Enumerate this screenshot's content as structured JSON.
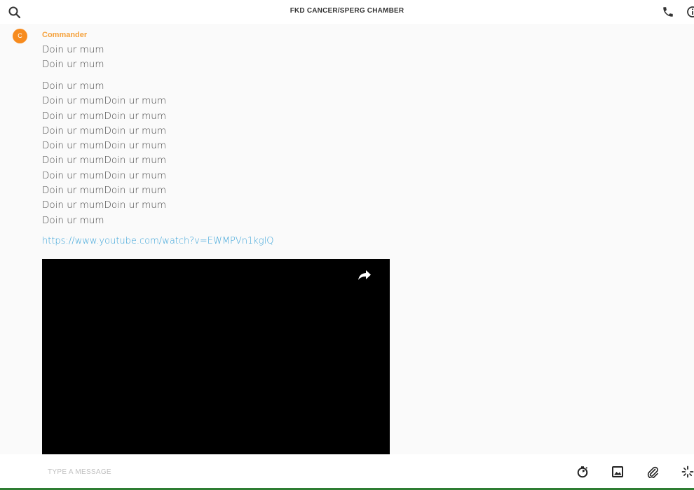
{
  "header": {
    "title": "FKD CANCER/SPERG CHAMBER",
    "icons": {
      "search": "search-icon",
      "call": "phone-icon",
      "info": "info-icon"
    }
  },
  "message": {
    "avatar_initial": "C",
    "author": "Commander",
    "author_color": "#f5a13b",
    "avatar_color": "#f78b1e",
    "group1": [
      "Doin ur mum",
      "Doin ur mum"
    ],
    "group2": [
      "Doin ur mum",
      "Doin ur mumDoin ur mum",
      "Doin ur mumDoin ur mum",
      "Doin ur mumDoin ur mum",
      "Doin ur mumDoin ur mum",
      "Doin ur mumDoin ur mum",
      "Doin ur mumDoin ur mum",
      "Doin ur mumDoin ur mum",
      "Doin ur mumDoin ur mum",
      "Doin ur mum"
    ],
    "link": "https://www.youtube.com/watch?v=EWMPVn1kglQ",
    "link_color": "#3aa3d8",
    "video": {
      "share_icon": "share-arrow-icon"
    }
  },
  "composer": {
    "placeholder": "TYPE A MESSAGE",
    "value": "",
    "tools": [
      "timer-icon",
      "image-icon",
      "paperclip-icon",
      "sparkle-icon"
    ]
  }
}
